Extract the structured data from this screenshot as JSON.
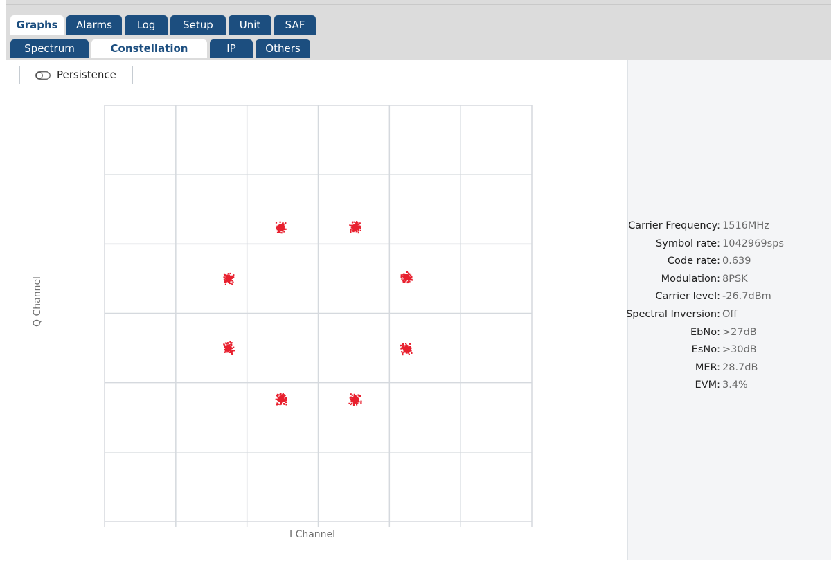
{
  "tabs_row1": [
    {
      "label": "Graphs",
      "active": true
    },
    {
      "label": "Alarms",
      "active": false
    },
    {
      "label": "Log",
      "active": false
    },
    {
      "label": "Setup",
      "active": false
    },
    {
      "label": "Unit",
      "active": false
    },
    {
      "label": "SAF",
      "active": false
    }
  ],
  "tabs_row2": [
    {
      "label": "Spectrum",
      "active": false
    },
    {
      "label": "Constellation",
      "active": true
    },
    {
      "label": "IP",
      "active": false
    },
    {
      "label": "Others",
      "active": false
    }
  ],
  "toolbar": {
    "persistence_label": "Persistence",
    "persistence_enabled": false
  },
  "chart_data": {
    "type": "scatter",
    "modulation": "8PSK",
    "xlabel": "I Channel",
    "ylabel": "Q Channel",
    "grid": true,
    "xlim": [
      -3,
      3
    ],
    "ylim": [
      -3,
      3
    ],
    "point_color": "#e8202e",
    "points": [
      {
        "x": -0.52,
        "y": 1.24
      },
      {
        "x": 0.52,
        "y": 1.24
      },
      {
        "x": 1.24,
        "y": 0.52
      },
      {
        "x": 1.24,
        "y": -0.52
      },
      {
        "x": 0.52,
        "y": -1.24
      },
      {
        "x": -0.52,
        "y": -1.24
      },
      {
        "x": -1.26,
        "y": -0.5
      },
      {
        "x": -1.26,
        "y": 0.5
      }
    ]
  },
  "info": [
    {
      "label": "Carrier Frequency:",
      "value": "1516MHz"
    },
    {
      "label": "Symbol rate:",
      "value": "1042969sps"
    },
    {
      "label": "Code rate:",
      "value": "0.639"
    },
    {
      "label": "Modulation:",
      "value": "8PSK"
    },
    {
      "label": "Carrier level:",
      "value": "-26.7dBm"
    },
    {
      "label": "Spectral Inversion:",
      "value": "Off"
    },
    {
      "label": "EbNo:",
      "value": ">27dB"
    },
    {
      "label": "EsNo:",
      "value": ">30dB"
    },
    {
      "label": "MER:",
      "value": "28.7dB"
    },
    {
      "label": "EVM:",
      "value": "3.4%"
    }
  ]
}
